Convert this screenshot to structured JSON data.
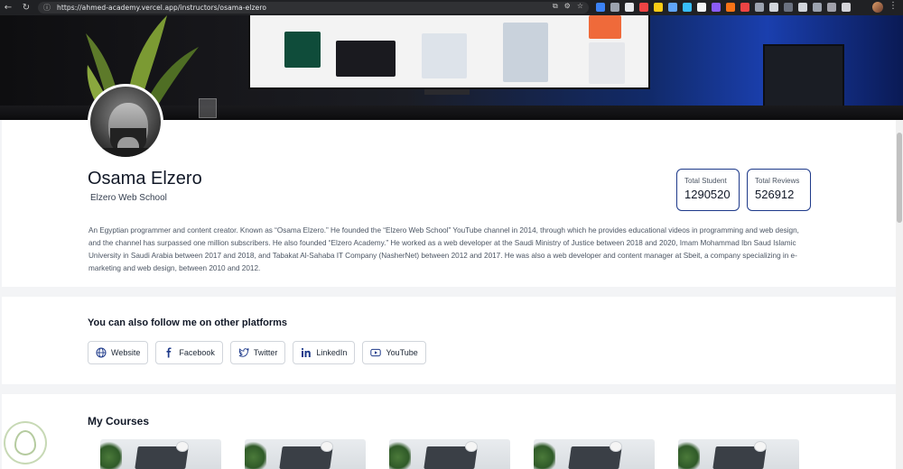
{
  "browser": {
    "url": "https://ahmed-academy.vercel.app/instructors/osama-elzero",
    "back_icon": "arrow-left-icon",
    "forward_icon": "arrow-right-icon",
    "reload_icon": "reload-icon"
  },
  "profile": {
    "name": "Osama Elzero",
    "school": "Elzero Web School",
    "bio": "An Egyptian programmer and content creator. Known as “Osama Elzero.” He founded the “Elzero Web School” YouTube channel in 2014, through which he provides educational videos in programming and web design, and the channel has surpassed one million subscribers. He also founded “Elzero Academy.” He worked as a web developer at the Saudi Ministry of Justice between 2018 and 2020, Imam Mohammad Ibn Saud Islamic University in Saudi Arabia between 2017 and 2018, and Tabakat Al-Sahaba IT Company (NasherNet) between 2012 and 2017. He was also a web developer and content manager at Sbeit, a company specializing in e-marketing and web design, between 2010 and 2012."
  },
  "stats": {
    "students_label": "Total Student",
    "students_value": "1290520",
    "reviews_label": "Total Reviews",
    "reviews_value": "526912"
  },
  "follow": {
    "title": "You can also follow me on other platforms",
    "links": [
      {
        "label": "Website",
        "icon": "globe-icon"
      },
      {
        "label": "Facebook",
        "icon": "facebook-icon"
      },
      {
        "label": "Twitter",
        "icon": "twitter-icon"
      },
      {
        "label": "LinkedIn",
        "icon": "linkedin-icon"
      },
      {
        "label": "YouTube",
        "icon": "youtube-icon"
      }
    ]
  },
  "courses": {
    "title": "My Courses",
    "count_visible": 5
  },
  "colors": {
    "accent_border": "#1e3a8a",
    "page_bg": "#ffffff",
    "band_bg": "#f3f4f6"
  }
}
